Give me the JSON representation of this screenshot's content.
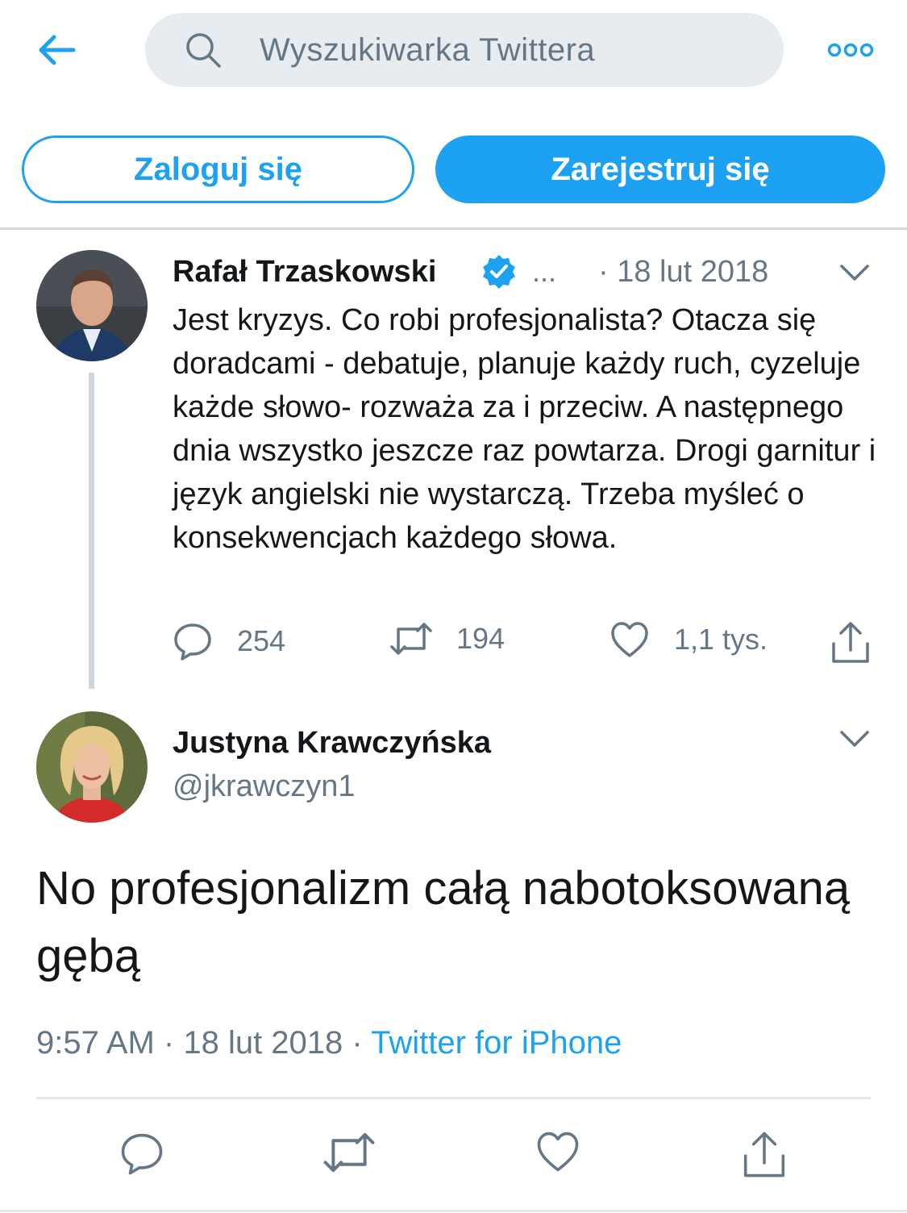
{
  "header": {
    "search_placeholder": "Wyszukiwarka Twittera",
    "accent_color": "#1da1f2"
  },
  "auth": {
    "login_label": "Zaloguj się",
    "signup_label": "Zarejestruj się"
  },
  "parent_tweet": {
    "author_name": "Rafał Trzaskowski",
    "verified": true,
    "truncated_handle": "...",
    "date": "· 18 lut 2018",
    "text": "Jest kryzys. Co robi profesjonalista? Otacza się doradcami - debatuje, planuje każdy ruch, cyzeluje każde słowo- rozważa za i przeciw. A następnego dnia wszystko jeszcze raz powtarza. Drogi garnitur i język angielski nie wystarczą. Trzeba myśleć o konsekwencjach każdego słowa.",
    "replies": "254",
    "retweets": "194",
    "likes": "1,1 tys."
  },
  "reply_tweet": {
    "author_name": "Justyna Krawczyńska",
    "handle": "@jkrawczyn1",
    "text": "No profesjonalizm całą nabotoksowaną gębą",
    "time": "9:57 AM",
    "date": "18 lut 2018",
    "separator": "·",
    "source": "Twitter for iPhone"
  },
  "icons": [
    "back-arrow-icon",
    "search-icon",
    "more-icon",
    "verified-badge-icon",
    "chevron-down-icon",
    "reply-icon",
    "retweet-icon",
    "like-icon",
    "share-icon"
  ]
}
